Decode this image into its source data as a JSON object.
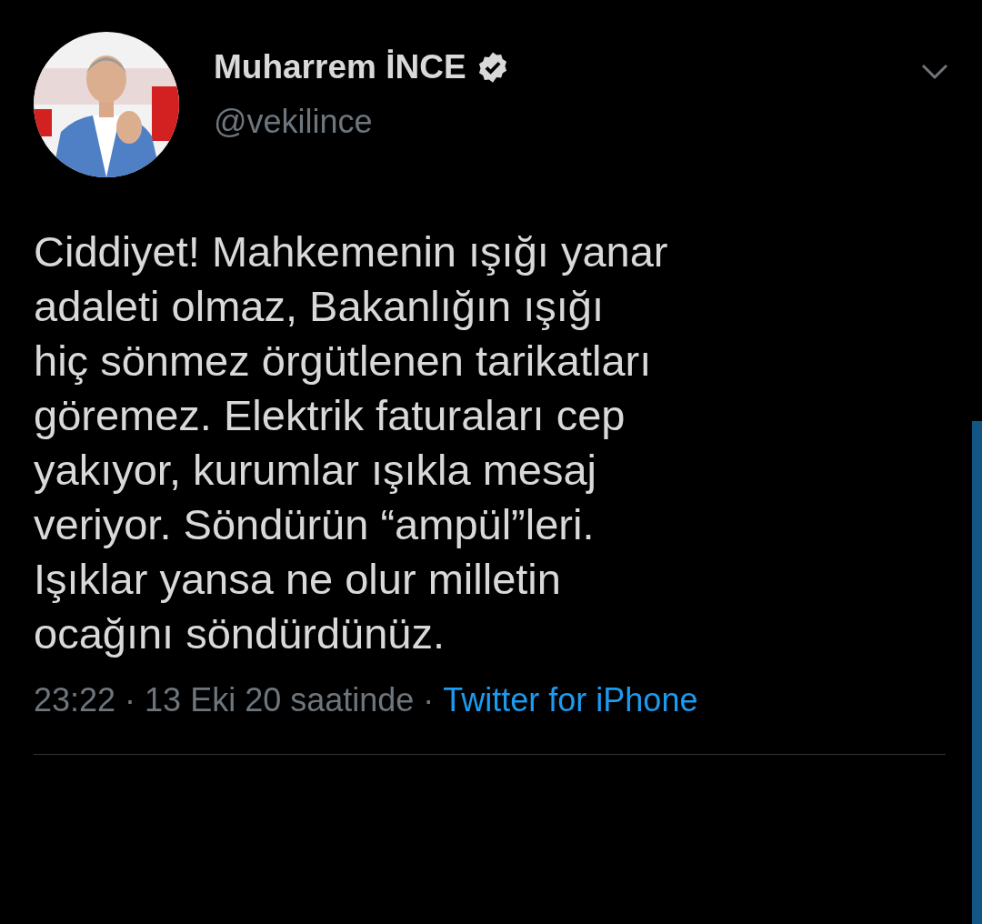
{
  "author": {
    "name": "Muharrem İNCE",
    "verified": true,
    "handle": "@vekilince"
  },
  "tweet": {
    "text": "Ciddiyet! Mahkemenin ışığı yanar\nadaleti olmaz, Bakanlığın ışığı\nhiç sönmez örgütlenen tarikatları\ngöremez. Elektrik faturaları cep\nyakıyor, kurumlar ışıkla mesaj\nveriyor. Söndürün “ampül”leri.\nIşıklar yansa ne olur milletin\nocağını söndürdünüz."
  },
  "meta": {
    "time": "23:22",
    "separator_1": "·",
    "date": "13 Eki 20 saatinde",
    "separator_2": "·",
    "source": "Twitter for iPhone"
  }
}
